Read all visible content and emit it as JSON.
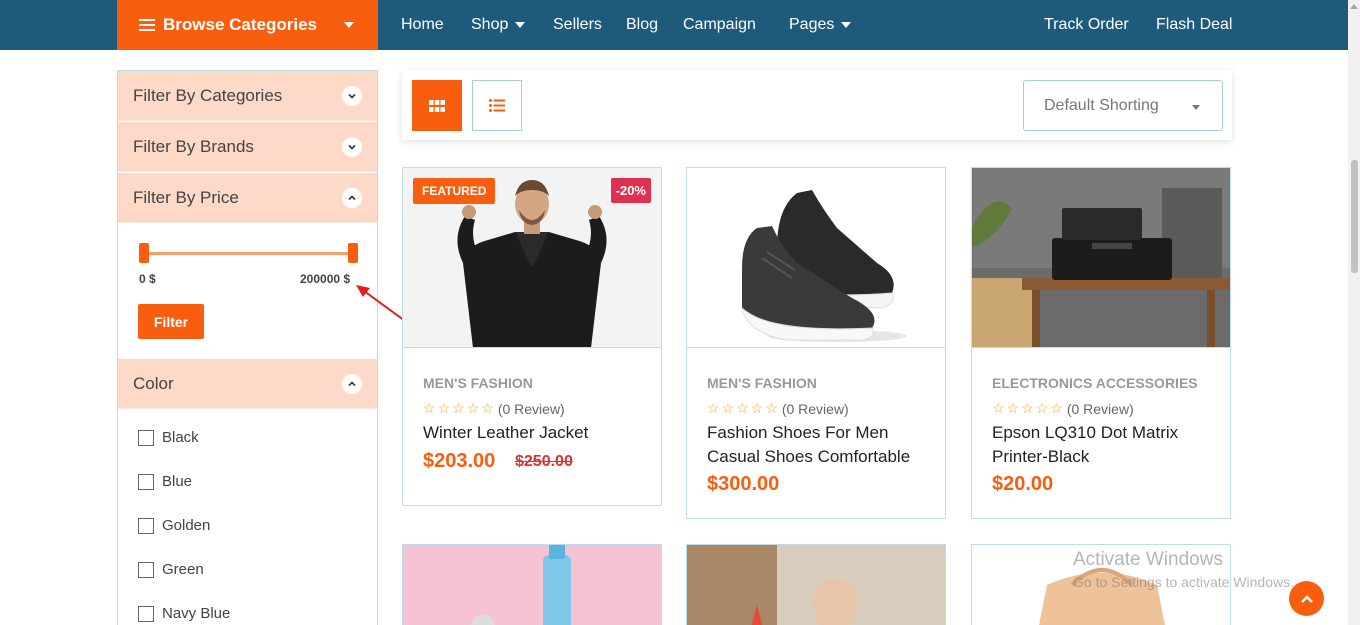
{
  "nav": {
    "browse_label": "Browse Categories",
    "items": [
      {
        "label": "Home"
      },
      {
        "label": "Shop"
      },
      {
        "label": "Sellers"
      },
      {
        "label": "Blog"
      },
      {
        "label": "Campaign"
      },
      {
        "label": "Pages"
      }
    ],
    "right": [
      {
        "label": "Track Order"
      },
      {
        "label": "Flash Deal"
      }
    ]
  },
  "sidebar": {
    "categories_label": "Filter By Categories",
    "brands_label": "Filter By Brands",
    "price_label": "Filter By Price",
    "price_min": "0 $",
    "price_max": "200000 $",
    "filter_button": "Filter",
    "color_label": "Color",
    "colors": [
      "Black",
      "Blue",
      "Golden",
      "Green",
      "Navy Blue"
    ]
  },
  "toolbar": {
    "sort_value": "Default Shorting"
  },
  "products": [
    {
      "category": "MEN'S FASHION",
      "reviews": "(0 Review)",
      "title": "Winter Leather Jacket",
      "price": "$203.00",
      "old_price": "$250.00",
      "badge": "FEATURED",
      "discount": "-20%"
    },
    {
      "category": "MEN'S FASHION",
      "reviews": "(0 Review)",
      "title": "Fashion Shoes For Men Casual Shoes Comfortable",
      "price": "$300.00"
    },
    {
      "category": "ELECTRONICS ACCESSORIES",
      "reviews": "(0 Review)",
      "title": "Epson LQ310 Dot Matrix Printer-Black",
      "price": "$20.00"
    }
  ],
  "watermark": {
    "line1": "Activate Windows",
    "line2": "Go to Settings to activate Windows."
  },
  "colors": {
    "accent": "#f95e0f",
    "nav_bg": "#1d5a7c",
    "filter_head_bg": "#fdd9c8"
  }
}
